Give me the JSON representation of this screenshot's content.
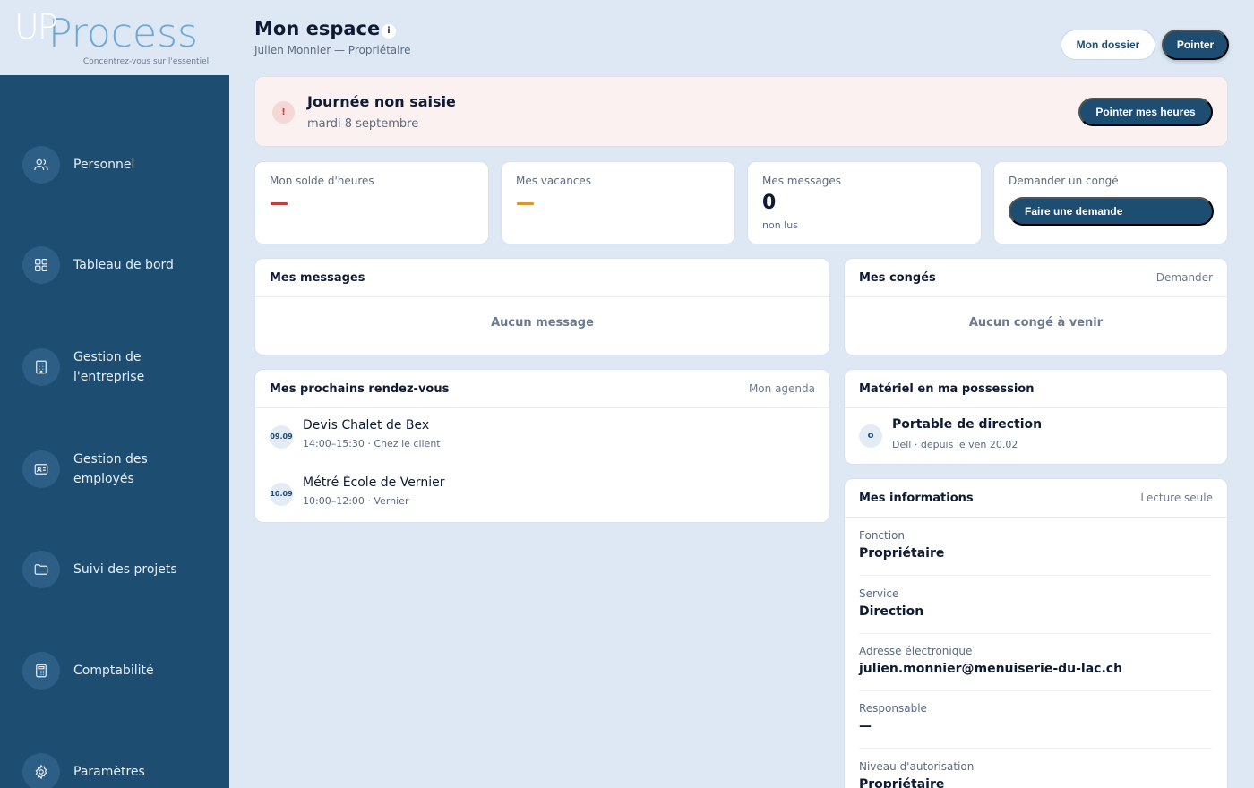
{
  "logo": {
    "part1": "UP",
    "part2": "Process",
    "tagline": "Concentrez-vous sur l'essentiel."
  },
  "sidebar": {
    "items": [
      {
        "label": "Personnel",
        "icon": "users-icon"
      },
      {
        "label": "Tableau de bord",
        "icon": "grid-icon"
      },
      {
        "label": "Gestion de l'entreprise",
        "icon": "building-icon"
      },
      {
        "label": "Gestion des employés",
        "icon": "id-card-icon"
      },
      {
        "label": "Suivi des projets",
        "icon": "folder-icon"
      },
      {
        "label": "Comptabilité",
        "icon": "calculator-icon"
      },
      {
        "label": "Paramètres",
        "icon": "gear-icon"
      }
    ]
  },
  "header": {
    "title": "Mon espace",
    "info_glyph": "i",
    "subtitle": "Julien Monnier — Propriétaire",
    "btn_dossier": "Mon dossier",
    "btn_pointer": "Pointer"
  },
  "alert": {
    "icon_glyph": "!",
    "title": "Journée non saisie",
    "date": "mardi 8 septembre",
    "button": "Pointer mes heures"
  },
  "stats": {
    "solde": {
      "label": "Mon solde d'heures",
      "value": "—",
      "color": "#c43c3c"
    },
    "vacances": {
      "label": "Mes vacances",
      "value": "—",
      "color": "#d9982f"
    },
    "messages": {
      "label": "Mes messages",
      "value": "0",
      "sub": "non lus"
    },
    "conge": {
      "label": "Demander un congé",
      "button": "Faire une demande"
    }
  },
  "messages_panel": {
    "title": "Mes messages",
    "empty": "Aucun message"
  },
  "conges_panel": {
    "title": "Mes congés",
    "link": "Demander",
    "empty": "Aucun congé à venir"
  },
  "rdv_panel": {
    "title": "Mes prochains rendez-vous",
    "link": "Mon agenda",
    "items": [
      {
        "date": "09.09",
        "title": "Devis Chalet de Bex",
        "sub": "14:00–15:30 · Chez le client"
      },
      {
        "date": "10.09",
        "title": "Métré École de Vernier",
        "sub": "10:00–12:00 · Vernier"
      }
    ]
  },
  "materiel_panel": {
    "title": "Matériel en ma possession",
    "icon_glyph": "o",
    "item_title": "Portable de direction",
    "item_sub": "Dell · depuis le ven 20.02"
  },
  "infos_panel": {
    "title": "Mes informations",
    "link": "Lecture seule",
    "rows": [
      {
        "label": "Fonction",
        "value": "Propriétaire"
      },
      {
        "label": "Service",
        "value": "Direction"
      },
      {
        "label": "Adresse électronique",
        "value": "julien.monnier@menuiserie-du-lac.ch"
      },
      {
        "label": "Responsable",
        "value": "—"
      },
      {
        "label": "Niveau d'autorisation",
        "value": "Propriétaire"
      }
    ]
  }
}
